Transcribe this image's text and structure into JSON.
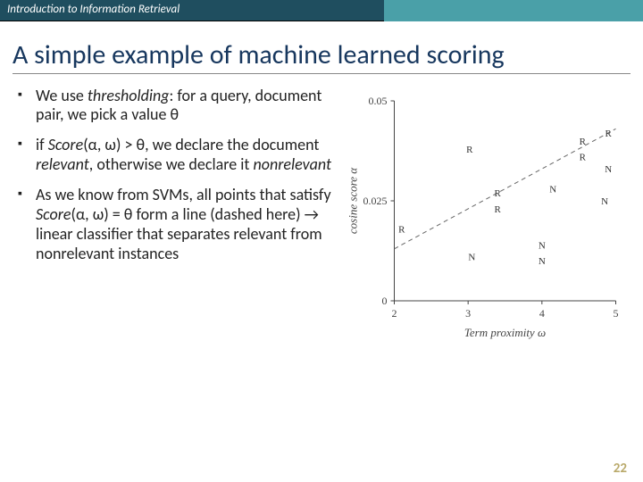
{
  "header": {
    "course": "Introduction to Information Retrieval"
  },
  "title": "A simple example of machine learned scoring",
  "bullets": [
    {
      "pre": "We use ",
      "em1": "thresholding",
      "post1": ": for a query, document pair, we pick a value θ"
    },
    {
      "pre": "if ",
      "em1": "Score",
      "post1": "(α, ω) > θ, we declare the document ",
      "em2": "relevant",
      "post2": ", otherwise we declare it ",
      "em3": "nonrelevant"
    },
    {
      "pre": "As we know from SVMs, all points that satisfy ",
      "em1": "Score",
      "post1": "(α, ω) = θ form a line (dashed here) → linear classifier that separates relevant from nonrelevant instances"
    }
  ],
  "page_number": "22",
  "chart_data": {
    "type": "scatter",
    "xlabel": "Term proximity ω",
    "ylabel": "cosine score α",
    "xlim": [
      2,
      5
    ],
    "ylim": [
      0,
      0.05
    ],
    "xticks": [
      2,
      3,
      4,
      5
    ],
    "yticks": [
      0,
      0.025,
      0.05
    ],
    "points": [
      {
        "x": 3.02,
        "y": 0.038,
        "label": "R"
      },
      {
        "x": 4.55,
        "y": 0.04,
        "label": "R"
      },
      {
        "x": 4.55,
        "y": 0.036,
        "label": "R"
      },
      {
        "x": 4.9,
        "y": 0.042,
        "label": "R"
      },
      {
        "x": 4.9,
        "y": 0.033,
        "label": "N"
      },
      {
        "x": 3.4,
        "y": 0.027,
        "label": "R"
      },
      {
        "x": 3.4,
        "y": 0.023,
        "label": "R"
      },
      {
        "x": 4.15,
        "y": 0.028,
        "label": "N"
      },
      {
        "x": 4.85,
        "y": 0.025,
        "label": "N"
      },
      {
        "x": 2.1,
        "y": 0.018,
        "label": "R"
      },
      {
        "x": 3.05,
        "y": 0.011,
        "label": "N"
      },
      {
        "x": 4.0,
        "y": 0.014,
        "label": "N"
      },
      {
        "x": 4.0,
        "y": 0.01,
        "label": "N"
      }
    ],
    "decision_line": {
      "x1": 2.0,
      "y1": 0.013,
      "x2": 5.0,
      "y2": 0.043
    }
  }
}
